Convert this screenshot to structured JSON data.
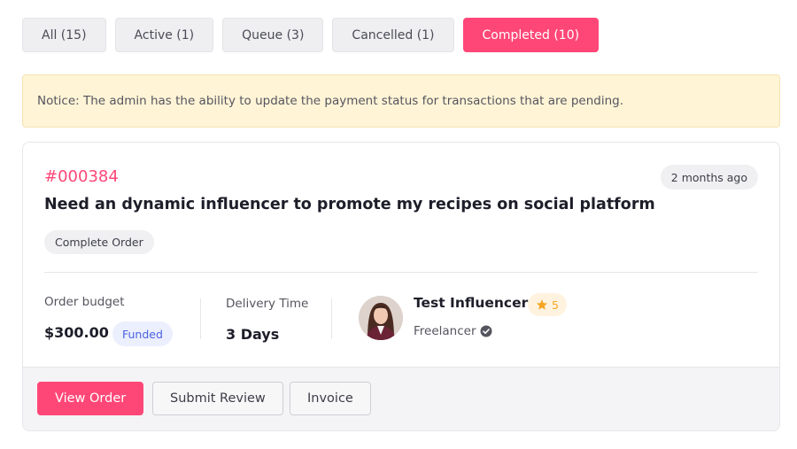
{
  "tabs": [
    {
      "label": "All (15)",
      "active": false
    },
    {
      "label": "Active (1)",
      "active": false
    },
    {
      "label": "Queue (3)",
      "active": false
    },
    {
      "label": "Cancelled (1)",
      "active": false
    },
    {
      "label": "Completed (10)",
      "active": true
    }
  ],
  "notice": {
    "text": "Notice: The admin has the ability to update the payment status for transactions that are pending."
  },
  "order": {
    "id": "#000384",
    "time_ago": "2 months ago",
    "title": "Need an dynamic influencer to promote my recipes on social platform",
    "status": "Complete Order",
    "budget_label": "Order budget",
    "budget_amount": "$300.00",
    "budget_badge": "Funded",
    "delivery_label": "Delivery Time",
    "delivery_value": "3 Days",
    "user": {
      "name": "Test Influencer",
      "rating": "5",
      "role": "Freelancer",
      "avatar_icon": "avatar-photo",
      "verified_icon": "verified-check-icon"
    }
  },
  "actions": {
    "view_order": "View Order",
    "submit_review": "Submit Review",
    "invoice": "Invoice"
  },
  "colors": {
    "accent": "#ff4777",
    "notice_bg": "#fff4d6",
    "funded_text": "#4a62e0",
    "star": "#f5a623"
  }
}
